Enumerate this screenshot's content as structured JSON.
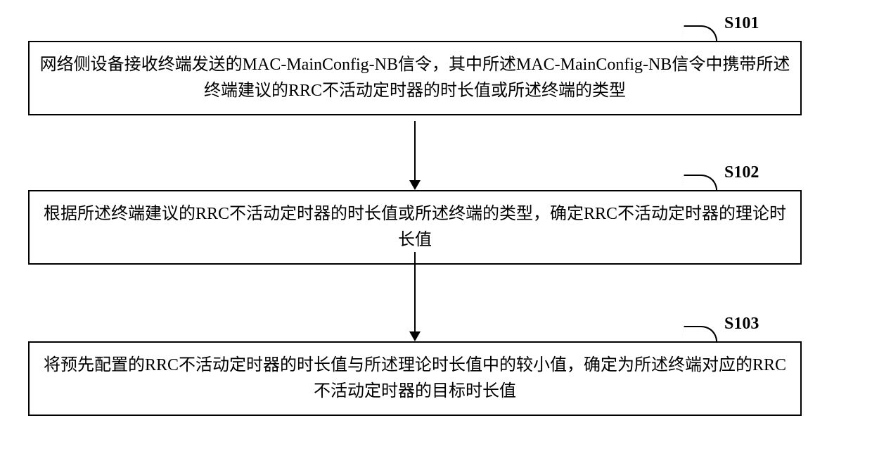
{
  "steps": [
    {
      "id": "S101",
      "text": "网络侧设备接收终端发送的MAC-MainConfig-NB信令，其中所述MAC-MainConfig-NB信令中携带所述终端建议的RRC不活动定时器的时长值或所述终端的类型"
    },
    {
      "id": "S102",
      "text": "根据所述终端建议的RRC不活动定时器的时长值或所述终端的类型，确定RRC不活动定时器的理论时长值"
    },
    {
      "id": "S103",
      "text": "将预先配置的RRC不活动定时器的时长值与所述理论时长值中的较小值，确定为所述终端对应的RRC不活动定时器的目标时长值"
    }
  ],
  "chart_data": {
    "type": "flowchart",
    "direction": "top-down",
    "nodes": [
      {
        "id": "S101",
        "label": "网络侧设备接收终端发送的MAC-MainConfig-NB信令，其中所述MAC-MainConfig-NB信令中携带所述终端建议的RRC不活动定时器的时长值或所述终端的类型"
      },
      {
        "id": "S102",
        "label": "根据所述终端建议的RRC不活动定时器的时长值或所述终端的类型，确定RRC不活动定时器的理论时长值"
      },
      {
        "id": "S103",
        "label": "将预先配置的RRC不活动定时器的时长值与所述理论时长值中的较小值，确定为所述终端对应的RRC不活动定时器的目标时长值"
      }
    ],
    "edges": [
      {
        "from": "S101",
        "to": "S102"
      },
      {
        "from": "S102",
        "to": "S103"
      }
    ]
  }
}
